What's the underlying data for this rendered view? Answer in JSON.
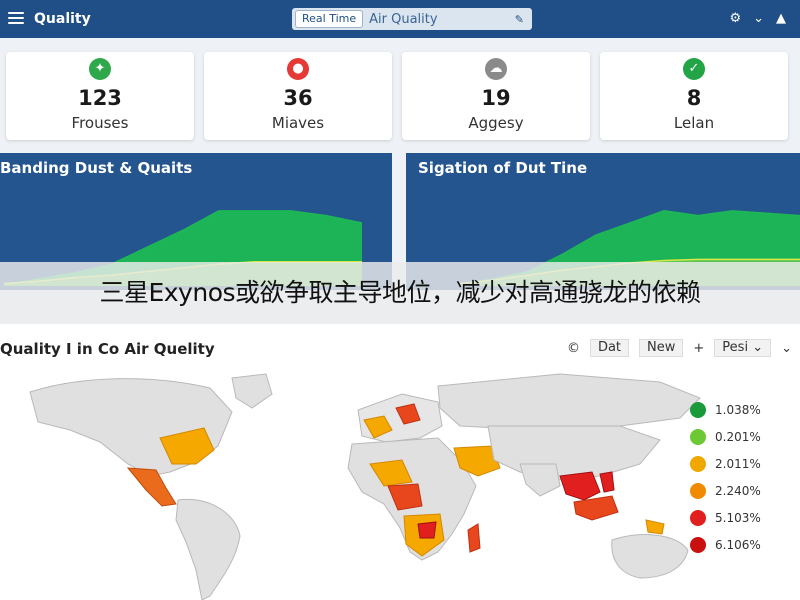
{
  "header": {
    "title": "Quality",
    "search_chip": "Real Time",
    "search_value": "Air Quality",
    "icons": [
      "settings-icon",
      "chevron-down-icon",
      "alert-icon"
    ]
  },
  "kpis": [
    {
      "value": "123",
      "label": "Frouses",
      "icon": "pin-icon",
      "color": "#2ea84a",
      "glyph": "✦"
    },
    {
      "value": "36",
      "label": "Miaves",
      "icon": "alert-icon",
      "color": "#e53935",
      "glyph": "●"
    },
    {
      "value": "19",
      "label": "Aggesy",
      "icon": "cloud-icon",
      "color": "#8a8a8a",
      "glyph": "☁"
    },
    {
      "value": "8",
      "label": "Lelan",
      "icon": "check-icon",
      "color": "#22a447",
      "glyph": "✓"
    }
  ],
  "charts": {
    "left": {
      "title": "Banding Dust & Quaits"
    },
    "right": {
      "title": "Sigation of Dut Tine"
    }
  },
  "chart_data": [
    {
      "type": "area",
      "title": "Banding Dust & Quaits",
      "x": [
        0,
        1,
        2,
        3,
        4,
        5,
        6,
        7,
        8,
        9,
        10
      ],
      "series": [
        {
          "values": [
            1,
            6,
            11,
            18,
            32,
            46,
            62,
            62,
            62,
            58,
            52
          ],
          "color": "#1db954"
        },
        {
          "values": [
            2,
            4,
            7,
            9,
            12,
            15,
            18,
            20,
            20,
            20,
            20
          ],
          "color": "#d6e84a"
        }
      ],
      "ylim": [
        0,
        80
      ]
    },
    {
      "type": "area",
      "title": "Sigation of Dut Tine",
      "x": [
        0,
        1,
        2,
        3,
        4,
        5,
        6,
        7,
        8,
        9,
        10
      ],
      "series": [
        {
          "values": [
            1,
            6,
            12,
            26,
            42,
            52,
            62,
            58,
            62,
            60,
            58
          ],
          "color": "#1db954"
        },
        {
          "values": [
            2,
            5,
            9,
            13,
            16,
            19,
            21,
            22,
            22,
            22,
            22
          ],
          "color": "#d6e84a"
        }
      ],
      "ylim": [
        0,
        80
      ]
    }
  ],
  "caption": "三星Exynos或欲争取主导地位，减少对高通骁龙的依赖",
  "map": {
    "title": "Quality I in Co Air Quelity",
    "tools": {
      "data_label": "Dat",
      "new_label": "New",
      "post_label": "Pesi"
    },
    "legend": [
      {
        "label": "1.038%",
        "color": "#1a9a3a"
      },
      {
        "label": "0.201%",
        "color": "#6cc934"
      },
      {
        "label": "2.011%",
        "color": "#f0a800"
      },
      {
        "label": "2.240%",
        "color": "#f28a00"
      },
      {
        "label": "5.103%",
        "color": "#e21f1f"
      },
      {
        "label": "6.106%",
        "color": "#c81010"
      }
    ]
  }
}
